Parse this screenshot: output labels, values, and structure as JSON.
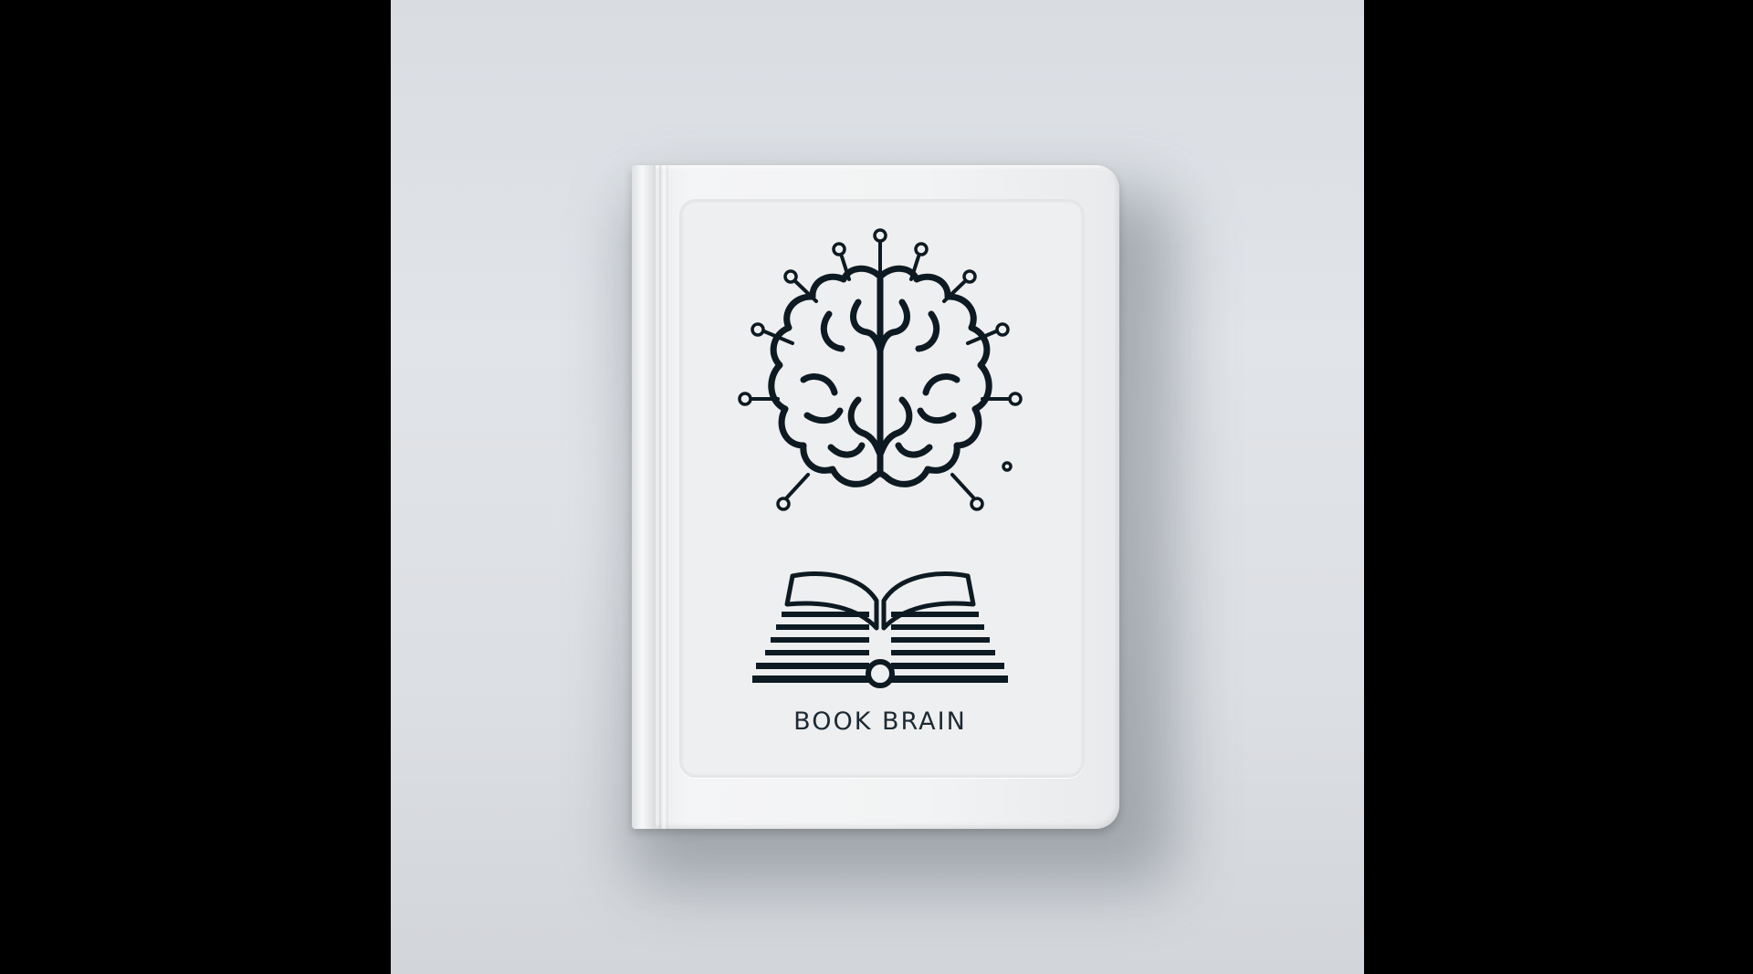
{
  "image": {
    "background_color": "#dde0e4",
    "letterbox_color": "#000000"
  },
  "book": {
    "title": "BOOK BRAIN",
    "cover_color": "#f2f3f4",
    "ink_color": "#0d1a22",
    "illustration_icons": [
      "brain-icon",
      "open-book-icon"
    ]
  }
}
